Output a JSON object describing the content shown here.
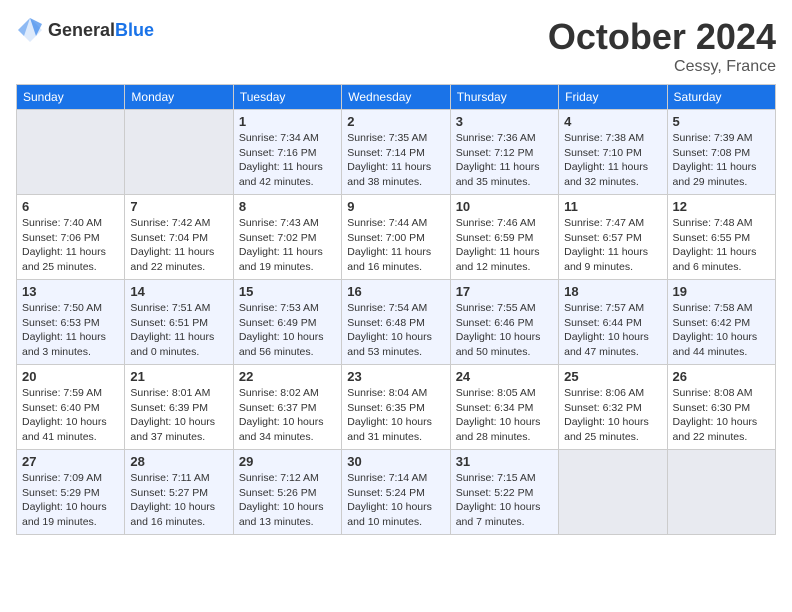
{
  "header": {
    "logo_general": "General",
    "logo_blue": "Blue",
    "month": "October 2024",
    "location": "Cessy, France"
  },
  "weekdays": [
    "Sunday",
    "Monday",
    "Tuesday",
    "Wednesday",
    "Thursday",
    "Friday",
    "Saturday"
  ],
  "weeks": [
    [
      {
        "day": "",
        "empty": true
      },
      {
        "day": "",
        "empty": true
      },
      {
        "day": "1",
        "sunrise": "Sunrise: 7:34 AM",
        "sunset": "Sunset: 7:16 PM",
        "daylight": "Daylight: 11 hours and 42 minutes."
      },
      {
        "day": "2",
        "sunrise": "Sunrise: 7:35 AM",
        "sunset": "Sunset: 7:14 PM",
        "daylight": "Daylight: 11 hours and 38 minutes."
      },
      {
        "day": "3",
        "sunrise": "Sunrise: 7:36 AM",
        "sunset": "Sunset: 7:12 PM",
        "daylight": "Daylight: 11 hours and 35 minutes."
      },
      {
        "day": "4",
        "sunrise": "Sunrise: 7:38 AM",
        "sunset": "Sunset: 7:10 PM",
        "daylight": "Daylight: 11 hours and 32 minutes."
      },
      {
        "day": "5",
        "sunrise": "Sunrise: 7:39 AM",
        "sunset": "Sunset: 7:08 PM",
        "daylight": "Daylight: 11 hours and 29 minutes."
      }
    ],
    [
      {
        "day": "6",
        "sunrise": "Sunrise: 7:40 AM",
        "sunset": "Sunset: 7:06 PM",
        "daylight": "Daylight: 11 hours and 25 minutes."
      },
      {
        "day": "7",
        "sunrise": "Sunrise: 7:42 AM",
        "sunset": "Sunset: 7:04 PM",
        "daylight": "Daylight: 11 hours and 22 minutes."
      },
      {
        "day": "8",
        "sunrise": "Sunrise: 7:43 AM",
        "sunset": "Sunset: 7:02 PM",
        "daylight": "Daylight: 11 hours and 19 minutes."
      },
      {
        "day": "9",
        "sunrise": "Sunrise: 7:44 AM",
        "sunset": "Sunset: 7:00 PM",
        "daylight": "Daylight: 11 hours and 16 minutes."
      },
      {
        "day": "10",
        "sunrise": "Sunrise: 7:46 AM",
        "sunset": "Sunset: 6:59 PM",
        "daylight": "Daylight: 11 hours and 12 minutes."
      },
      {
        "day": "11",
        "sunrise": "Sunrise: 7:47 AM",
        "sunset": "Sunset: 6:57 PM",
        "daylight": "Daylight: 11 hours and 9 minutes."
      },
      {
        "day": "12",
        "sunrise": "Sunrise: 7:48 AM",
        "sunset": "Sunset: 6:55 PM",
        "daylight": "Daylight: 11 hours and 6 minutes."
      }
    ],
    [
      {
        "day": "13",
        "sunrise": "Sunrise: 7:50 AM",
        "sunset": "Sunset: 6:53 PM",
        "daylight": "Daylight: 11 hours and 3 minutes."
      },
      {
        "day": "14",
        "sunrise": "Sunrise: 7:51 AM",
        "sunset": "Sunset: 6:51 PM",
        "daylight": "Daylight: 11 hours and 0 minutes."
      },
      {
        "day": "15",
        "sunrise": "Sunrise: 7:53 AM",
        "sunset": "Sunset: 6:49 PM",
        "daylight": "Daylight: 10 hours and 56 minutes."
      },
      {
        "day": "16",
        "sunrise": "Sunrise: 7:54 AM",
        "sunset": "Sunset: 6:48 PM",
        "daylight": "Daylight: 10 hours and 53 minutes."
      },
      {
        "day": "17",
        "sunrise": "Sunrise: 7:55 AM",
        "sunset": "Sunset: 6:46 PM",
        "daylight": "Daylight: 10 hours and 50 minutes."
      },
      {
        "day": "18",
        "sunrise": "Sunrise: 7:57 AM",
        "sunset": "Sunset: 6:44 PM",
        "daylight": "Daylight: 10 hours and 47 minutes."
      },
      {
        "day": "19",
        "sunrise": "Sunrise: 7:58 AM",
        "sunset": "Sunset: 6:42 PM",
        "daylight": "Daylight: 10 hours and 44 minutes."
      }
    ],
    [
      {
        "day": "20",
        "sunrise": "Sunrise: 7:59 AM",
        "sunset": "Sunset: 6:40 PM",
        "daylight": "Daylight: 10 hours and 41 minutes."
      },
      {
        "day": "21",
        "sunrise": "Sunrise: 8:01 AM",
        "sunset": "Sunset: 6:39 PM",
        "daylight": "Daylight: 10 hours and 37 minutes."
      },
      {
        "day": "22",
        "sunrise": "Sunrise: 8:02 AM",
        "sunset": "Sunset: 6:37 PM",
        "daylight": "Daylight: 10 hours and 34 minutes."
      },
      {
        "day": "23",
        "sunrise": "Sunrise: 8:04 AM",
        "sunset": "Sunset: 6:35 PM",
        "daylight": "Daylight: 10 hours and 31 minutes."
      },
      {
        "day": "24",
        "sunrise": "Sunrise: 8:05 AM",
        "sunset": "Sunset: 6:34 PM",
        "daylight": "Daylight: 10 hours and 28 minutes."
      },
      {
        "day": "25",
        "sunrise": "Sunrise: 8:06 AM",
        "sunset": "Sunset: 6:32 PM",
        "daylight": "Daylight: 10 hours and 25 minutes."
      },
      {
        "day": "26",
        "sunrise": "Sunrise: 8:08 AM",
        "sunset": "Sunset: 6:30 PM",
        "daylight": "Daylight: 10 hours and 22 minutes."
      }
    ],
    [
      {
        "day": "27",
        "sunrise": "Sunrise: 7:09 AM",
        "sunset": "Sunset: 5:29 PM",
        "daylight": "Daylight: 10 hours and 19 minutes."
      },
      {
        "day": "28",
        "sunrise": "Sunrise: 7:11 AM",
        "sunset": "Sunset: 5:27 PM",
        "daylight": "Daylight: 10 hours and 16 minutes."
      },
      {
        "day": "29",
        "sunrise": "Sunrise: 7:12 AM",
        "sunset": "Sunset: 5:26 PM",
        "daylight": "Daylight: 10 hours and 13 minutes."
      },
      {
        "day": "30",
        "sunrise": "Sunrise: 7:14 AM",
        "sunset": "Sunset: 5:24 PM",
        "daylight": "Daylight: 10 hours and 10 minutes."
      },
      {
        "day": "31",
        "sunrise": "Sunrise: 7:15 AM",
        "sunset": "Sunset: 5:22 PM",
        "daylight": "Daylight: 10 hours and 7 minutes."
      },
      {
        "day": "",
        "empty": true
      },
      {
        "day": "",
        "empty": true
      }
    ]
  ]
}
